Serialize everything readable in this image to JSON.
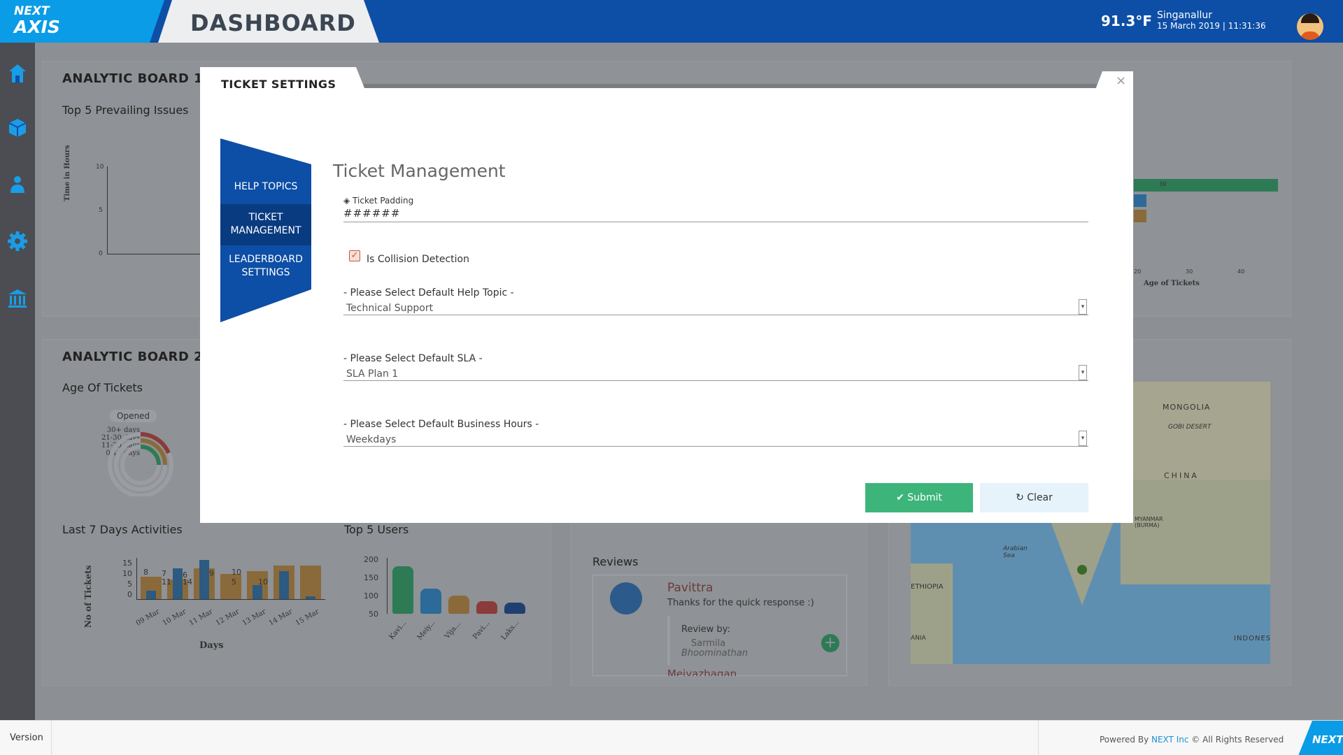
{
  "brand": {
    "line1": "NEXT",
    "line2": "AXIS"
  },
  "header": {
    "title": "DASHBOARD",
    "temperature": "91.3°F",
    "location": "Singanallur",
    "datetime": "15 March 2019 | 11:31:36"
  },
  "sidebar": {
    "icons": [
      "home-icon",
      "cube-icon",
      "users-icon",
      "gear-icon",
      "bank-icon"
    ]
  },
  "background": {
    "board1_title": "ANALYTIC BOARD 1",
    "board1_sub": "Top 5 Prevailing Issues",
    "board1_ylabel": "Time in Hours",
    "board1_yticks": [
      "10",
      "5",
      "0"
    ],
    "board1_right_xlabel": "Age of Tickets",
    "board1_right_ticks": [
      "20",
      "30",
      "40"
    ],
    "board1_right_barlabel": "39",
    "board2_title": "ANALYTIC BOARD 2",
    "board2_sub": "Age Of Tickets",
    "opened_badge": "Opened",
    "age_legend": [
      "30+ days",
      "21-30 days",
      "11-20 days",
      "0-10 days"
    ],
    "last7_title": "Last 7 Days Activities",
    "last7_ylabel": "No of Tickets",
    "last7_xlabel": "Days",
    "last7_yticks": [
      "15",
      "10",
      "5",
      "0"
    ],
    "last7_days": [
      "09 Mar",
      "10 Mar",
      "11 Mar",
      "12 Mar",
      "13 Mar",
      "14 Mar",
      "15 Mar"
    ],
    "last7_labels": [
      "8",
      "7",
      "11",
      "6",
      "14",
      "9",
      "10",
      "5",
      "10"
    ],
    "top5_title": "Top 5 Users",
    "top5_yticks": [
      "200",
      "150",
      "100",
      "50"
    ],
    "top5_users": [
      "Kavi...",
      "Meiy...",
      "Vija...",
      "Pavi...",
      "Laks..."
    ],
    "reviews_title": "Reviews",
    "review_name": "Pavittra",
    "review_text": "Thanks for the quick response :)",
    "review_by_label": "Review by:",
    "review_by_1": "Sarmila",
    "review_by_2": "Bhoominathan",
    "review_next": "Meiyazhagan",
    "map_labels": [
      "MONGOLIA",
      "GOBI DESERT",
      "CHINA",
      "MYANMAR (BURMA)",
      "Arabian Sea",
      "ETHIOPIA",
      "ANIA",
      "INDONES"
    ]
  },
  "modal": {
    "title": "TICKET SETTINGS",
    "close": "×",
    "nav": [
      {
        "label": "HELP TOPICS"
      },
      {
        "label_line1": "TICKET",
        "label_line2": "MANAGEMENT"
      },
      {
        "label_line1": "LEADERBOARD",
        "label_line2": "SETTINGS"
      }
    ],
    "section_title": "Ticket Management",
    "padding_label": "Ticket Padding",
    "padding_value": "######",
    "collision_label": "Is Collision Detection",
    "collision_checked": true,
    "help_topic_label": "- Please Select Default Help Topic -",
    "help_topic_value": "Technical Support",
    "sla_label": "- Please Select Default SLA -",
    "sla_value": "SLA Plan 1",
    "hours_label": "- Please Select Default Business Hours -",
    "hours_value": "Weekdays",
    "submit_label": "Submit",
    "clear_label": "Clear"
  },
  "footer": {
    "version": "Version",
    "powered_prefix": "Powered By ",
    "powered_company": "NEXT Inc",
    "powered_suffix": " © All Rights Reserved",
    "logo": "NEXT"
  }
}
